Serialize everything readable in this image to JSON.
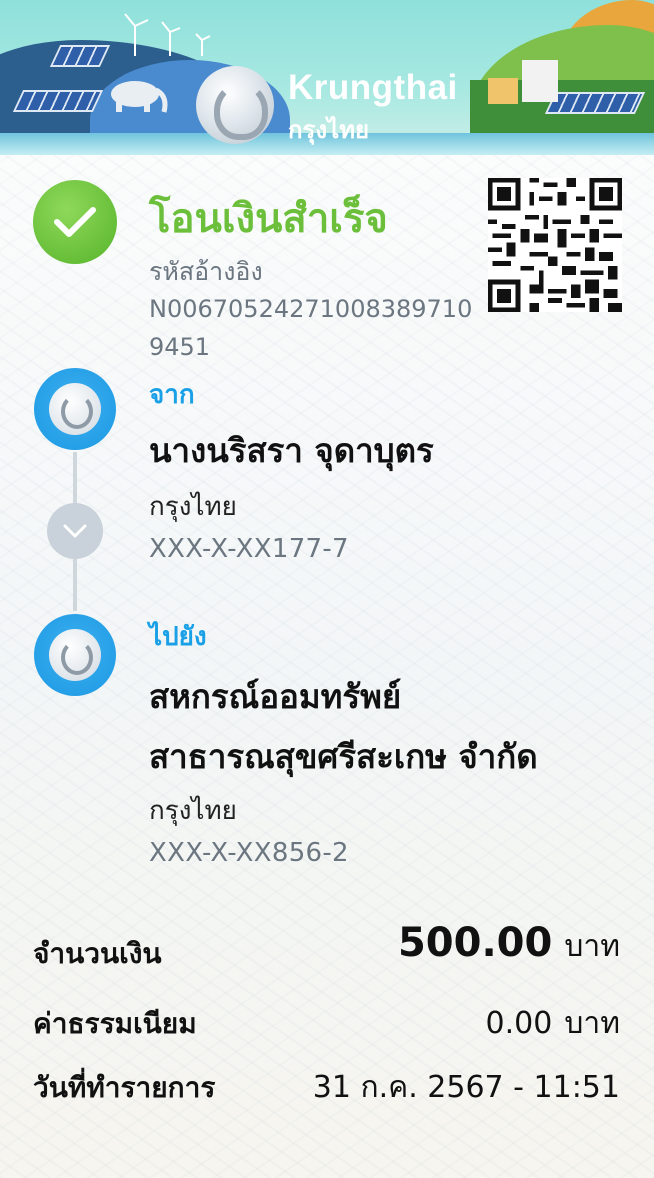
{
  "header": {
    "brand_en": "Krungthai",
    "brand_th": "กรุงไทย"
  },
  "status": {
    "title": "โอนเงินสำเร็จ",
    "ref_label": "รหัสอ้างอิง",
    "ref_value": "N006705242710083897109451",
    "color": "#6cbf3a"
  },
  "from": {
    "label": "จาก",
    "name": "นางนริสรา  จุดาบุตร",
    "bank": "กรุงไทย",
    "account": "XXX-X-XX177-7"
  },
  "to": {
    "label": "ไปยัง",
    "name_line1": "สหกรณ์ออมทรัพย์",
    "name_line2": "สาธารณสุขศรีสะเกษ จำกัด",
    "bank": "กรุงไทย",
    "account": "XXX-X-XX856-2"
  },
  "details": {
    "amount_label": "จำนวนเงิน",
    "amount_value": "500.00",
    "amount_unit": "บาท",
    "fee_label": "ค่าธรรมเนียม",
    "fee_value": "0.00",
    "fee_unit": "บาท",
    "date_label": "วันที่ทำรายการ",
    "date_value": "31 ก.ค. 2567 - 11:51"
  },
  "colors": {
    "accent_blue": "#1aa0e6",
    "success_green": "#6cbf3a"
  }
}
